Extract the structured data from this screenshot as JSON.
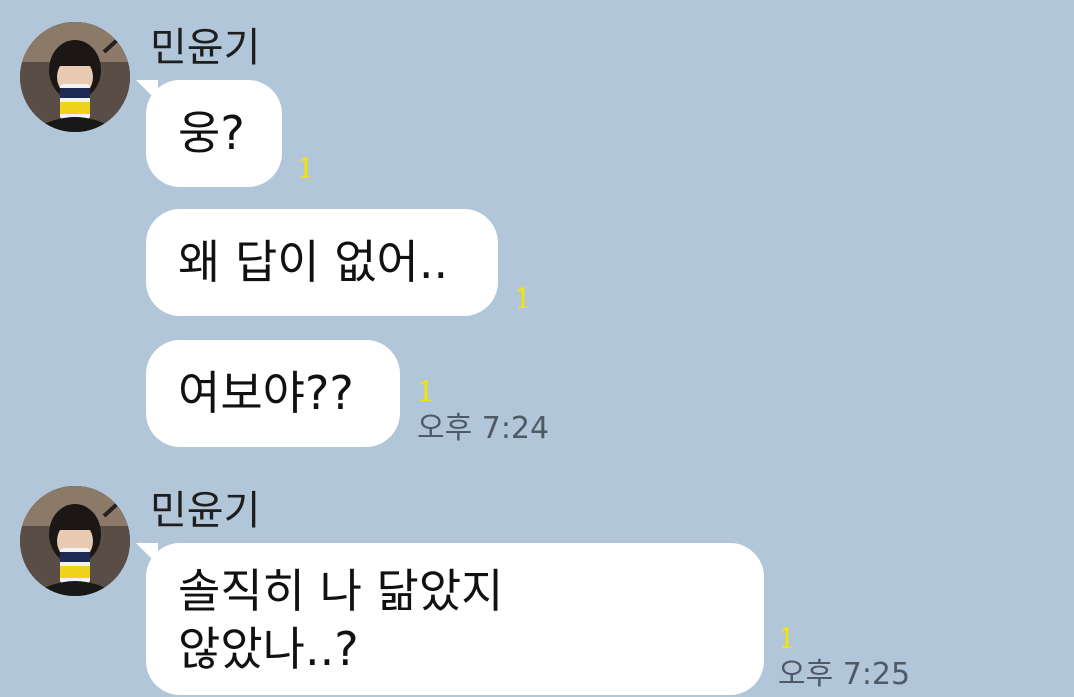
{
  "colors": {
    "background": "#b1c6d9",
    "bubble": "#ffffff",
    "unread": "#f4e400",
    "time": "#4e5a66"
  },
  "groups": [
    {
      "sender": "민윤기",
      "messages": [
        {
          "text": "웅?",
          "unread": "1"
        },
        {
          "text": "왜 답이 없어..",
          "unread": "1"
        },
        {
          "text": "여보야??",
          "unread": "1",
          "time": "오후 7:24"
        }
      ]
    },
    {
      "sender": "민윤기",
      "messages": [
        {
          "lines": [
            "솔직히 나 닮았지",
            "않았나..?"
          ],
          "unread": "1",
          "time": "오후 7:25"
        }
      ]
    }
  ]
}
